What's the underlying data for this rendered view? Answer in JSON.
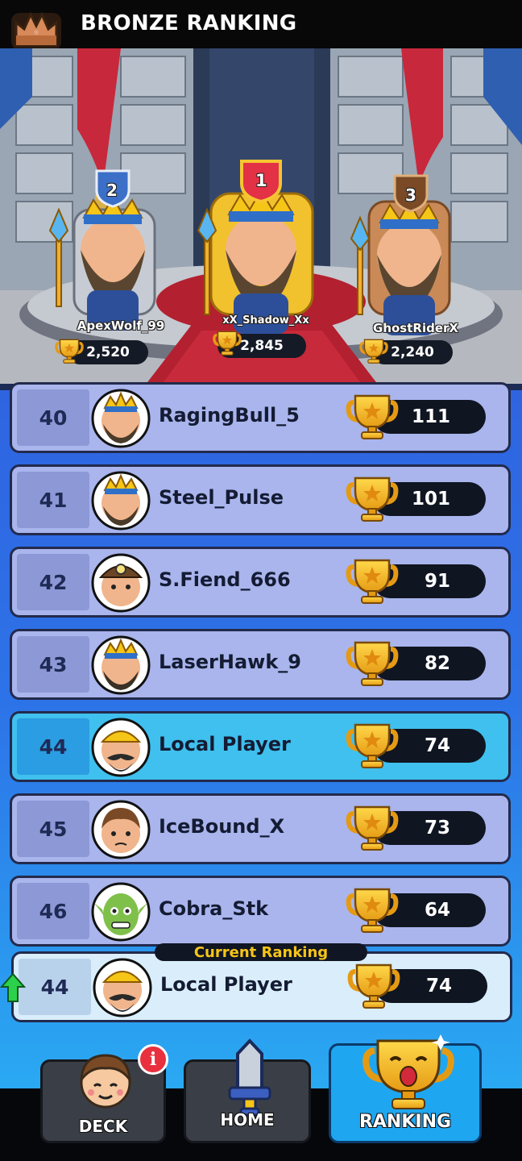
{
  "header": {
    "title": "BRONZE RANKING",
    "icon": "crown-icon"
  },
  "podium": [
    {
      "place": "1",
      "name": "xX_Shadow_Xx",
      "score": "2,845"
    },
    {
      "place": "2",
      "name": "ApexWolf_99",
      "score": "2,520"
    },
    {
      "place": "3",
      "name": "GhostRiderX",
      "score": "2,240"
    }
  ],
  "ranking": [
    {
      "rank": "40",
      "name": "RagingBull_5",
      "score": "111",
      "avatar": "crowned-bearded-king"
    },
    {
      "rank": "41",
      "name": "Steel_Pulse",
      "score": "101",
      "avatar": "crowned-bearded-king"
    },
    {
      "rank": "42",
      "name": "S.Fiend_666",
      "score": "91",
      "avatar": "miner-helmet-face"
    },
    {
      "rank": "43",
      "name": "LaserHawk_9",
      "score": "82",
      "avatar": "crowned-bearded-king"
    },
    {
      "rank": "44",
      "name": "Local Player",
      "score": "74",
      "avatar": "mustached-bandana-face",
      "highlighted": true
    },
    {
      "rank": "45",
      "name": "IceBound_X",
      "score": "73",
      "avatar": "brown-hair-boy"
    },
    {
      "rank": "46",
      "name": "Cobra_Stk",
      "score": "64",
      "avatar": "green-goblin"
    }
  ],
  "current": {
    "label": "Current Ranking",
    "rank": "44",
    "name": "Local Player",
    "score": "74"
  },
  "nav": {
    "deck": {
      "label": "DECK",
      "badge": "i"
    },
    "home": {
      "label": "HOME"
    },
    "ranking": {
      "label": "RANKING",
      "active": true
    }
  },
  "colors": {
    "accent": "#1fa6f0",
    "gold": "#f5c518",
    "list_bg": "#2f64e0",
    "row": "#a9b5ec",
    "row_highlight": "#3fc0ee"
  }
}
